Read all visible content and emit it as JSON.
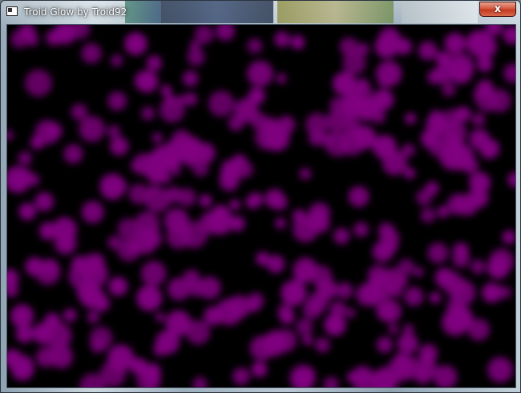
{
  "window": {
    "title": "Troid Glow by Troid92",
    "close_label": "x"
  },
  "canvas": {
    "background_color": "#000000",
    "glow_color": "#800080",
    "content_description": "dense field of blurred glowing purple circles"
  },
  "colors": {
    "close_button": "#c8452b",
    "title_text": "#ffffff"
  }
}
